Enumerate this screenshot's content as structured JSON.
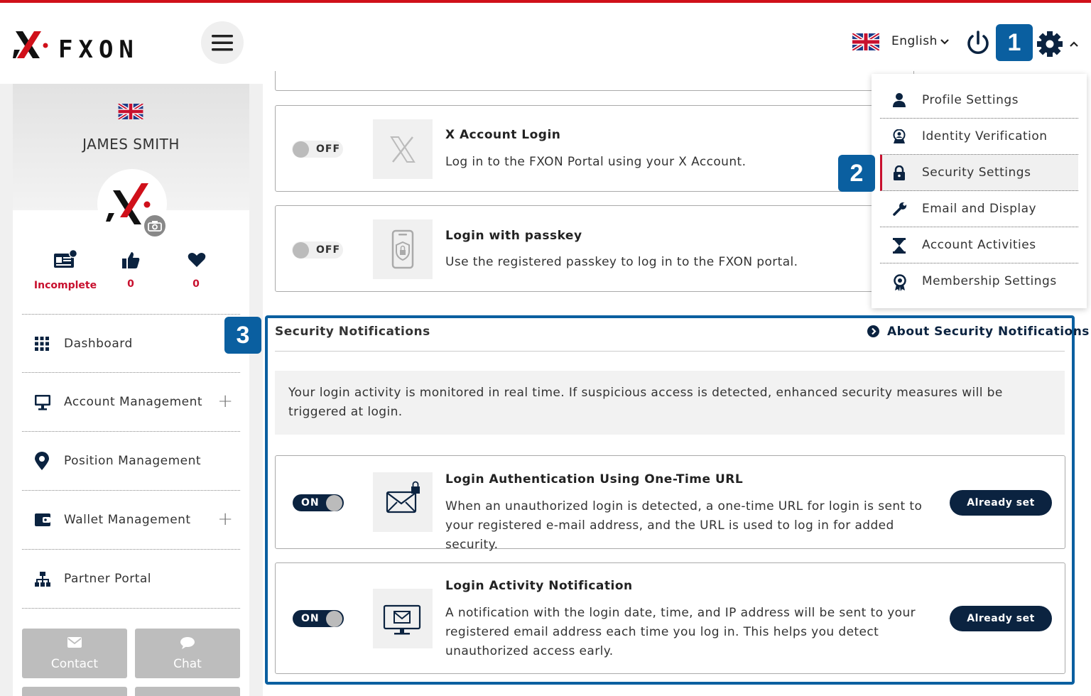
{
  "header": {
    "brand": "FXON",
    "language": "English",
    "badges": [
      "1",
      "2",
      "3"
    ]
  },
  "sidebar": {
    "user_name": "JAMES SMITH",
    "stats": [
      {
        "icon": "id-card-icon",
        "value": "Incomplete"
      },
      {
        "icon": "thumbs-up-icon",
        "value": "0"
      },
      {
        "icon": "heart-icon",
        "value": "0"
      }
    ],
    "nav": [
      {
        "icon": "grid-icon",
        "label": "Dashboard",
        "expandable": false
      },
      {
        "icon": "monitor-icon",
        "label": "Account Management",
        "expandable": true
      },
      {
        "icon": "map-pin-icon",
        "label": "Position Management",
        "expandable": false
      },
      {
        "icon": "wallet-icon",
        "label": "Wallet Management",
        "expandable": true
      },
      {
        "icon": "org-chart-icon",
        "label": "Partner Portal",
        "expandable": false
      }
    ],
    "buttons": [
      {
        "icon": "envelope-icon",
        "label": "Contact"
      },
      {
        "icon": "chat-bubble-icon",
        "label": "Chat"
      }
    ]
  },
  "main": {
    "login_options": [
      {
        "toggle": "OFF",
        "title": "X Account Login",
        "desc": "Log in to the FXON Portal using your X Account."
      },
      {
        "toggle": "OFF",
        "title": "Login with passkey",
        "desc": "Use the registered passkey to log in to the FXON portal."
      }
    ],
    "security_notifications": {
      "title": "Security Notifications",
      "about_link": "About Security Notifications",
      "info": "Your login activity is monitored in real time. If suspicious access is detected, enhanced security measures will be triggered at login.",
      "items": [
        {
          "toggle": "ON",
          "title": "Login Authentication Using One-Time URL",
          "desc": "When an unauthorized login is detected, a one-time URL for login is sent to your registered e-mail address, and the URL is used to log in for added security.",
          "button": "Already set"
        },
        {
          "toggle": "ON",
          "title": "Login Activity Notification",
          "desc": "A notification with the login date, time, and IP address will be sent to your registered email address each time you log in. This helps you detect unauthorized access early.",
          "button": "Already set"
        }
      ]
    }
  },
  "settings_menu": [
    {
      "icon": "user-icon",
      "label": "Profile Settings"
    },
    {
      "icon": "id-verify-icon",
      "label": "Identity Verification"
    },
    {
      "icon": "lock-icon",
      "label": "Security Settings",
      "active": true
    },
    {
      "icon": "wrench-icon",
      "label": "Email and Display"
    },
    {
      "icon": "hourglass-icon",
      "label": "Account Activities"
    },
    {
      "icon": "award-icon",
      "label": "Membership Settings"
    }
  ],
  "colors": {
    "brand_red": "#c8102e",
    "navy": "#0b2340",
    "badge_blue": "#0a5fa0"
  }
}
